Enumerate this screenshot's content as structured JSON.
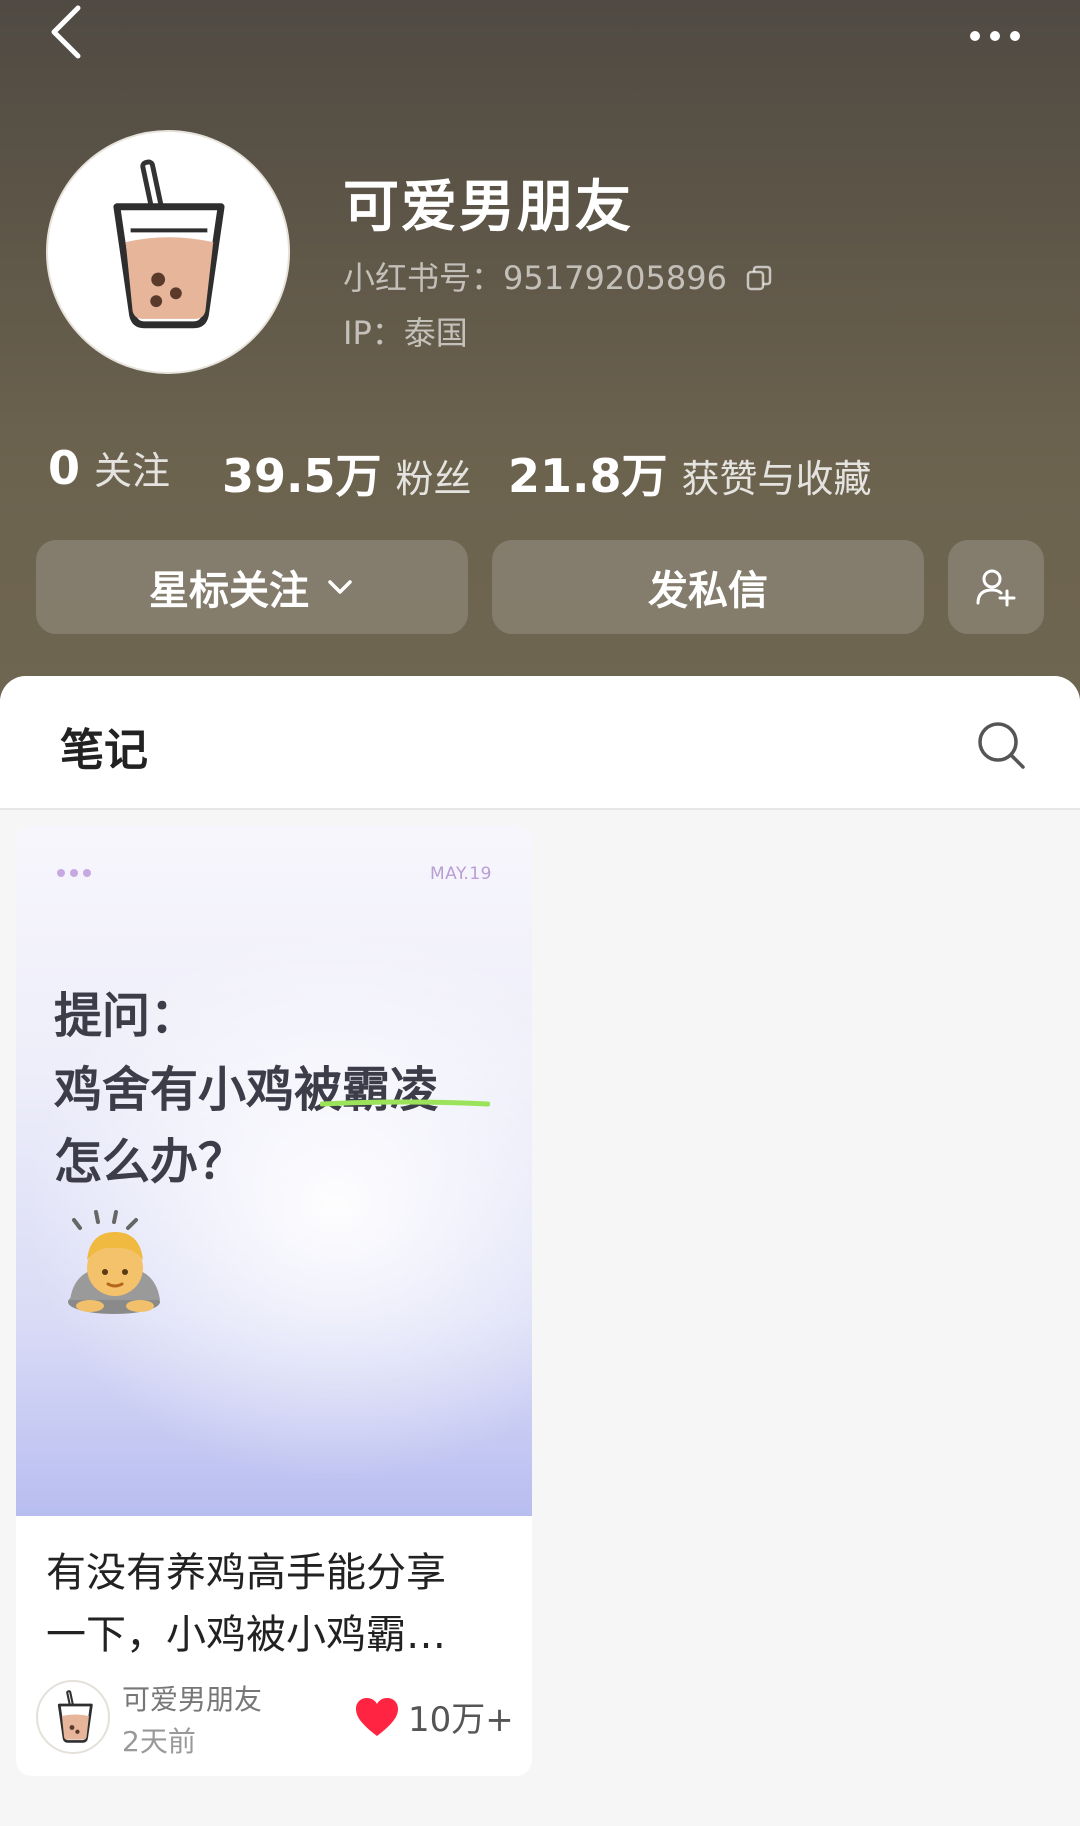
{
  "header": {
    "back_icon": "chevron-left-icon",
    "more_icon": "more-horizontal-icon",
    "nickname": "可爱男朋友",
    "redid": "小红书号：95179205896",
    "ip": "IP：泰国"
  },
  "stats": [
    {
      "value": "0",
      "label": "关注"
    },
    {
      "value": "39.5万",
      "label": "粉丝"
    },
    {
      "value": "21.8万",
      "label": "获赞与收藏"
    }
  ],
  "actions": {
    "star_follow": "星标关注",
    "message": "发私信",
    "add_friend_icon": "add-user-icon"
  },
  "tabs": {
    "notes": "笔记",
    "search_icon": "search-icon"
  },
  "notes": [
    {
      "cover": {
        "date": "MAY.19",
        "line1": "提问：",
        "line2": "鸡舍有小鸡被霸凌",
        "line3": "怎么办？"
      },
      "title_line1": "有没有养鸡高手能分享",
      "title_line2": "一下，小鸡被小鸡霸…",
      "author": "可爱男朋友",
      "time": "2天前",
      "likes": "10万+"
    }
  ],
  "colors": {
    "header_top": "#4f4a43",
    "header_bottom": "#6f6651",
    "like_red": "#ff2442",
    "cover_accent": "#b8bdf0"
  }
}
